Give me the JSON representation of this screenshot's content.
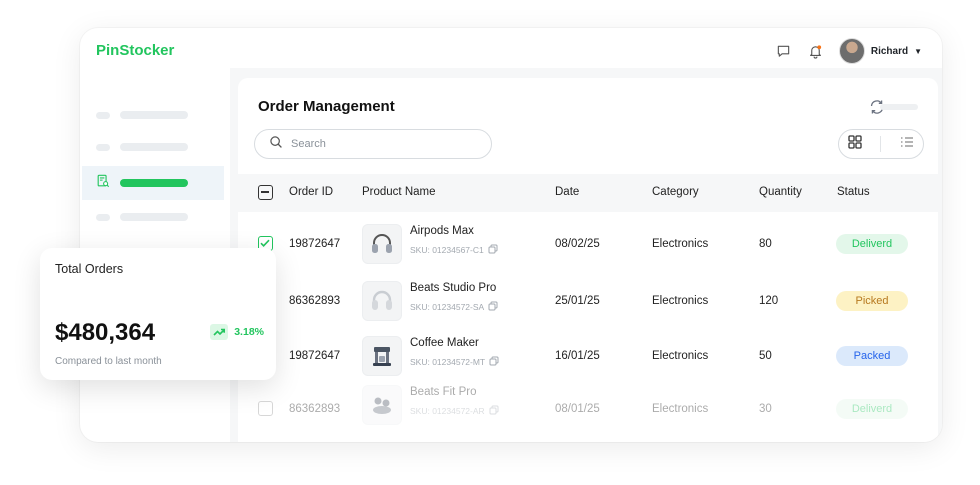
{
  "app": {
    "brand": "PinStocker"
  },
  "topbar": {
    "user_name": "Richard",
    "icons": [
      "chat-icon",
      "bell-icon"
    ]
  },
  "sidebar": {
    "active_index": 2,
    "items": 4
  },
  "main": {
    "title": "Order Management",
    "search": {
      "placeholder": "Search",
      "value": ""
    },
    "columns": [
      "Order ID",
      "Product Name",
      "Date",
      "Category",
      "Quantity",
      "Status"
    ]
  },
  "orders": [
    {
      "checked": true,
      "order_id": "19872647",
      "product": "Airpods Max",
      "sku": "SKU: 01234567-C1",
      "date": "08/02/25",
      "category": "Electronics",
      "quantity": "80",
      "status": "Deliverd",
      "status_color": "#22c55e",
      "status_bg": "#e3f7ea",
      "icon": "headphones-icon"
    },
    {
      "checked": false,
      "order_id": "86362893",
      "product": "Beats Studio Pro",
      "sku": "SKU: 01234572-SA",
      "date": "25/01/25",
      "category": "Electronics",
      "quantity": "120",
      "status": "Picked",
      "status_color": "#b7791f",
      "status_bg": "#fdf2c4",
      "icon": "headphones-icon"
    },
    {
      "checked": false,
      "order_id": "19872647",
      "product": "Coffee Maker",
      "sku": "SKU: 01234572-MT",
      "date": "16/01/25",
      "category": "Electronics",
      "quantity": "50",
      "status": "Packed",
      "status_color": "#2563eb",
      "status_bg": "#dbe9fb",
      "icon": "coffee-maker-icon"
    },
    {
      "checked": false,
      "order_id": "86362893",
      "product": "Beats Fit Pro",
      "sku": "SKU: 01234572-AR",
      "date": "08/01/25",
      "category": "Electronics",
      "quantity": "30",
      "status": "Deliverd",
      "status_color": "#22c55e",
      "status_bg": "#e3f7ea",
      "icon": "earbuds-icon"
    }
  ],
  "summary_card": {
    "title": "Total Orders",
    "value": "$480,364",
    "change": "3.18%",
    "caption": "Compared to last month",
    "accent": "#22c55e"
  }
}
